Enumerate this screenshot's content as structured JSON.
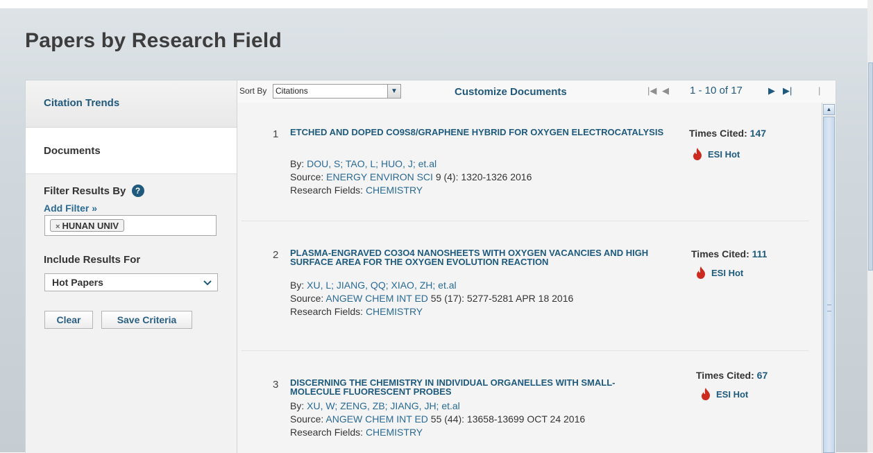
{
  "page": {
    "title": "Papers by Research Field"
  },
  "left_nav": {
    "citation_trends": "Citation Trends",
    "documents": "Documents"
  },
  "filters": {
    "heading": "Filter Results By",
    "help_glyph": "?",
    "add_filter": "Add Filter »",
    "chip_remove": "×",
    "active_filter": "HUNAN UNIV",
    "include_heading": "Include Results For",
    "include_value": "Hot Papers",
    "clear_label": "Clear",
    "save_label": "Save Criteria"
  },
  "toolbar": {
    "sort_label": "Sort By",
    "sort_value": "Citations",
    "customize": "Customize Documents",
    "pagination": {
      "first": "|◀",
      "prev": "◀",
      "range": "1 - 10 of 17",
      "next": "▶",
      "last": "▶|",
      "separator": "|"
    }
  },
  "results": [
    {
      "num": "1",
      "title": "ETCHED AND DOPED CO9S8/GRAPHENE HYBRID FOR OXYGEN ELECTROCATALYSIS",
      "by_label": "By:",
      "authors": "DOU, S;  TAO, L;  HUO, J;  et.al",
      "source_label": "Source:",
      "source": "ENERGY ENVIRON SCI",
      "source_detail": "9 (4): 1320-1326 2016",
      "fields_label": "Research Fields:",
      "fields": "CHEMISTRY",
      "cited_label": "Times Cited:",
      "cited": "147",
      "badge": "ESI Hot"
    },
    {
      "num": "2",
      "title": "PLASMA-ENGRAVED CO3O4 NANOSHEETS WITH OXYGEN VACANCIES AND HIGH SURFACE AREA FOR THE OXYGEN EVOLUTION REACTION",
      "by_label": "By:",
      "authors": "XU, L;  JIANG, QQ;  XIAO, ZH;  et.al",
      "source_label": "Source:",
      "source": "ANGEW CHEM INT ED",
      "source_detail": "55 (17): 5277-5281 APR 18 2016",
      "fields_label": "Research Fields:",
      "fields": "CHEMISTRY",
      "cited_label": "Times Cited:",
      "cited": "111",
      "badge": "ESI Hot"
    },
    {
      "num": "3",
      "title": "DISCERNING THE CHEMISTRY IN INDIVIDUAL ORGANELLES WITH SMALL-MOLECULE FLUORESCENT PROBES",
      "by_label": "By:",
      "authors": "XU, W;  ZENG, ZB;  JIANG, JH;  et.al",
      "source_label": "Source:",
      "source": "ANGEW CHEM INT ED",
      "source_detail": "55 (44): 13658-13699 OCT 24 2016",
      "fields_label": "Research Fields:",
      "fields": "CHEMISTRY",
      "cited_label": "Times Cited:",
      "cited": "67",
      "badge": "ESI Hot"
    }
  ],
  "icons": {
    "help": "help-icon",
    "remove": "close-icon",
    "dropdown": "chevron-down-icon",
    "badge": "flame-icon"
  },
  "colors": {
    "link": "#1e5a7e",
    "flame": "#cc2a1f",
    "help": "#1f5a7e"
  }
}
